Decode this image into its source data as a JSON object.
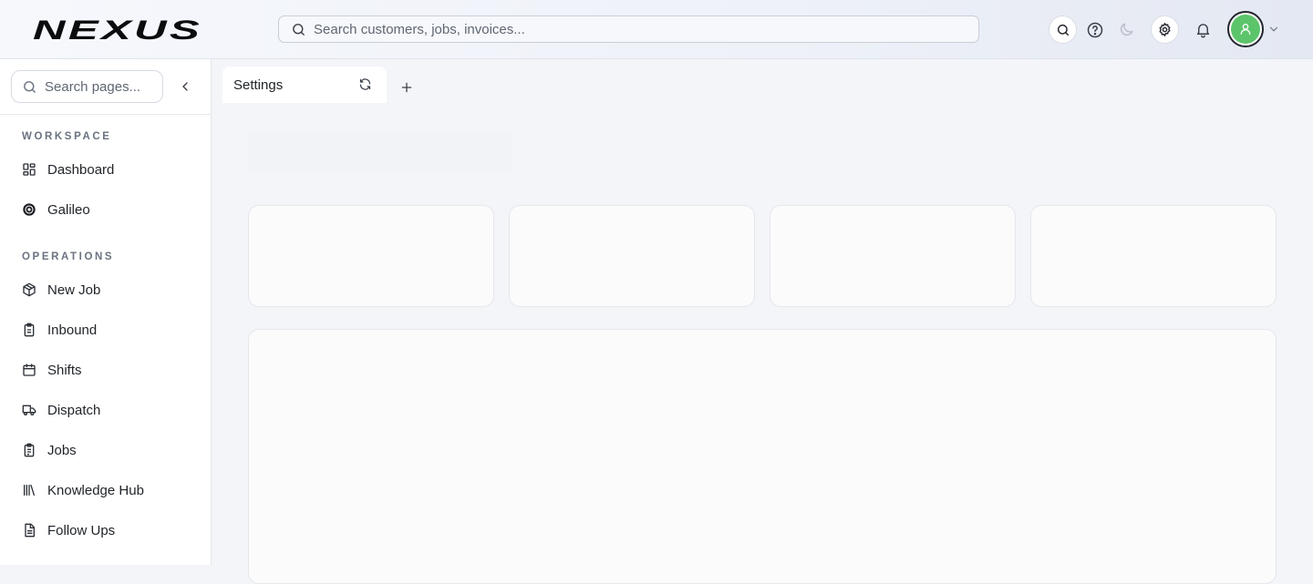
{
  "header": {
    "logo_text": "NEXUS",
    "search_placeholder": "Search customers, jobs, invoices...",
    "icons": [
      "search-icon",
      "help-icon",
      "moon-icon",
      "gear-icon",
      "bell-icon",
      "user-icon",
      "chevron-down-icon"
    ],
    "accent_color": "#5cc46b"
  },
  "sidebar": {
    "search_placeholder": "Search pages...",
    "sections": [
      {
        "label": "WORKSPACE",
        "items": [
          {
            "label": "Dashboard",
            "icon": "grid-icon"
          },
          {
            "label": "Galileo",
            "icon": "target-icon"
          }
        ]
      },
      {
        "label": "OPERATIONS",
        "items": [
          {
            "label": "New Job",
            "icon": "box-icon"
          },
          {
            "label": "Inbound",
            "icon": "clipboard-icon"
          },
          {
            "label": "Shifts",
            "icon": "calendar-icon"
          },
          {
            "label": "Dispatch",
            "icon": "truck-icon"
          },
          {
            "label": "Jobs",
            "icon": "clipboard-list-icon"
          },
          {
            "label": "Knowledge Hub",
            "icon": "library-icon"
          },
          {
            "label": "Follow Ups",
            "icon": "file-icon"
          }
        ]
      }
    ]
  },
  "tabs": [
    {
      "label": "Settings"
    }
  ]
}
